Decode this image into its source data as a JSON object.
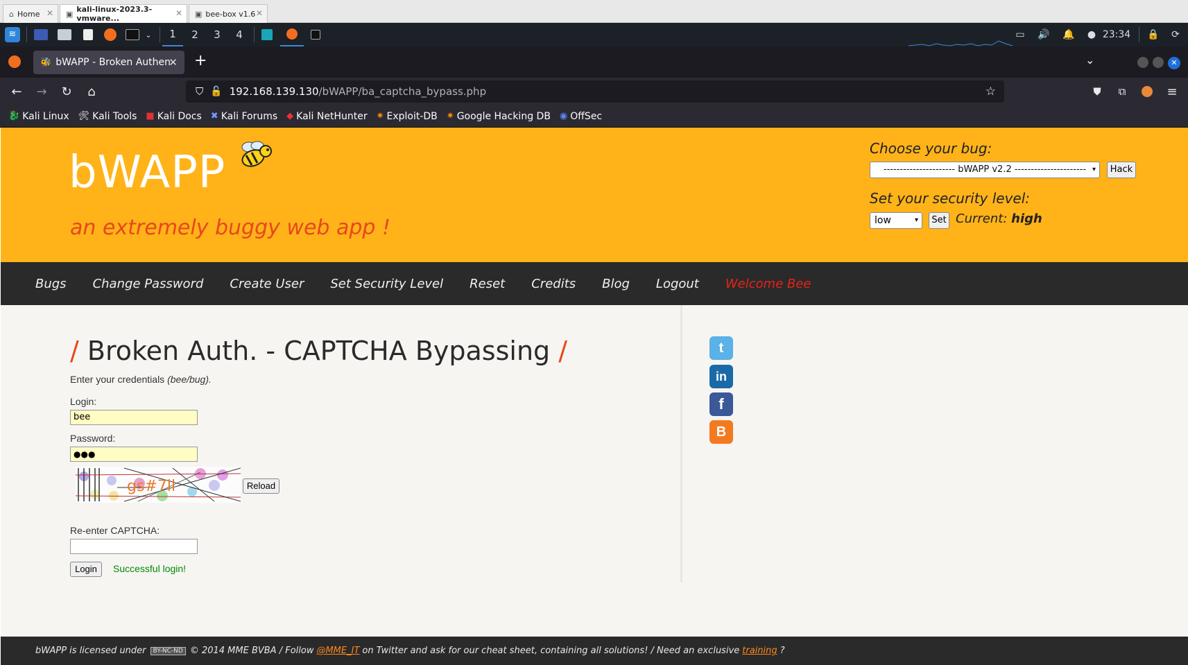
{
  "vmware": {
    "tabs": [
      {
        "label": "Home",
        "icon": "home-icon"
      },
      {
        "label": "kali-linux-2023.3-vmware...",
        "icon": "vm-icon"
      },
      {
        "label": "bee-box v1.6",
        "icon": "vm-icon"
      }
    ]
  },
  "kali_panel": {
    "workspaces": [
      "1",
      "2",
      "3",
      "4"
    ],
    "clock": "23:34"
  },
  "firefox": {
    "tab_title": "bWAPP - Broken Authent",
    "url_host": "192.168.139.130",
    "url_path": "/bWAPP/ba_captcha_bypass.php",
    "bookmarks": [
      {
        "label": "Kali Linux",
        "icon": "kali-icon"
      },
      {
        "label": "Kali Tools",
        "icon": "kali-tools-icon"
      },
      {
        "label": "Kali Docs",
        "icon": "kali-docs-icon"
      },
      {
        "label": "Kali Forums",
        "icon": "kali-forums-icon"
      },
      {
        "label": "Kali NetHunter",
        "icon": "nethunter-icon"
      },
      {
        "label": "Exploit-DB",
        "icon": "exploit-db-icon"
      },
      {
        "label": "Google Hacking DB",
        "icon": "ghdb-icon"
      },
      {
        "label": "OffSec",
        "icon": "offsec-icon"
      }
    ]
  },
  "bwapp": {
    "logo": "bWAPP",
    "tagline": "an extremely buggy web app !",
    "choose_bug_label": "Choose your bug:",
    "bug_select_value": "---------------------- bWAPP v2.2 ----------------------",
    "hack_button": "Hack",
    "security_label": "Set your security level:",
    "level_select_value": "low",
    "set_button": "Set",
    "current_label": "Current:",
    "current_value": "high",
    "menu": [
      "Bugs",
      "Change Password",
      "Create User",
      "Set Security Level",
      "Reset",
      "Credits",
      "Blog",
      "Logout"
    ],
    "welcome": "Welcome Bee",
    "page_title": "Broken Auth. - CAPTCHA Bypassing",
    "instructions_prefix": "Enter your credentials ",
    "instructions_hint": "(bee/bug).",
    "login_label": "Login:",
    "login_value": "bee",
    "password_label": "Password:",
    "password_value": "●●●",
    "captcha_text": "gs#7ll",
    "reload_button": "Reload",
    "recaptcha_label": "Re-enter CAPTCHA:",
    "recaptcha_value": "",
    "login_button": "Login",
    "status_message": "Successful login!",
    "social": [
      "twitter-icon",
      "linkedin-icon",
      "facebook-icon",
      "blogger-icon"
    ],
    "footer_prefix": "bWAPP is licensed under",
    "footer_license": "BY-NC-ND",
    "footer_middle_a": "© 2014 MME BVBA / Follow",
    "footer_twitter": "@MME_IT",
    "footer_middle_b": "on Twitter and ask for our cheat sheet, containing all solutions! / Need an exclusive",
    "footer_training": "training",
    "footer_end": "?"
  },
  "colors": {
    "header_bg": "#ffb319",
    "accent_orange": "#e8471b",
    "menu_bg": "#2a2a2a",
    "welcome_red": "#e8221b",
    "success_green": "#008a00"
  }
}
